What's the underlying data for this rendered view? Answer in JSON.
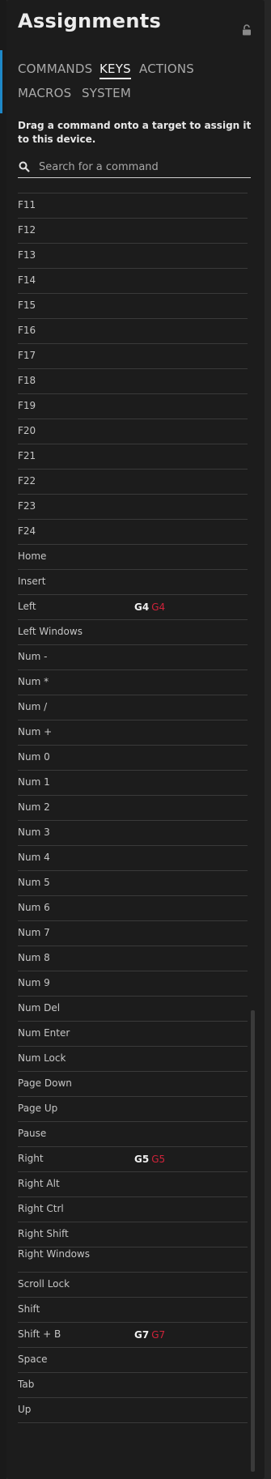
{
  "panel": {
    "title": "Assignments",
    "lock_icon": "unlock-icon"
  },
  "tabs": [
    {
      "label": "COMMANDS",
      "active": false
    },
    {
      "label": "KEYS",
      "active": true
    },
    {
      "label": "ACTIONS",
      "active": false
    },
    {
      "label": "MACROS",
      "active": false
    },
    {
      "label": "SYSTEM",
      "active": false
    }
  ],
  "instructions": "Drag a command onto a target to assign it to this device.",
  "search": {
    "placeholder": "Search for a command",
    "value": "",
    "icon": "search-icon"
  },
  "colors": {
    "accent": "#1e88c8",
    "assigned_red": "#d0233a"
  },
  "keys": [
    {
      "label": "F11"
    },
    {
      "label": "F12"
    },
    {
      "label": "F13"
    },
    {
      "label": "F14"
    },
    {
      "label": "F15"
    },
    {
      "label": "F16"
    },
    {
      "label": "F17"
    },
    {
      "label": "F18"
    },
    {
      "label": "F19"
    },
    {
      "label": "F20"
    },
    {
      "label": "F21"
    },
    {
      "label": "F22"
    },
    {
      "label": "F23"
    },
    {
      "label": "F24"
    },
    {
      "label": "Home"
    },
    {
      "label": "Insert"
    },
    {
      "label": "Left",
      "assigned": "G4",
      "assigned_alt": "G4"
    },
    {
      "label": "Left Windows"
    },
    {
      "label": "Num -"
    },
    {
      "label": "Num *"
    },
    {
      "label": "Num /"
    },
    {
      "label": "Num +"
    },
    {
      "label": "Num 0"
    },
    {
      "label": "Num 1"
    },
    {
      "label": "Num 2"
    },
    {
      "label": "Num 3"
    },
    {
      "label": "Num 4"
    },
    {
      "label": "Num 5"
    },
    {
      "label": "Num 6"
    },
    {
      "label": "Num 7"
    },
    {
      "label": "Num 8"
    },
    {
      "label": "Num 9"
    },
    {
      "label": "Num Del"
    },
    {
      "label": "Num Enter"
    },
    {
      "label": "Num Lock"
    },
    {
      "label": "Page Down"
    },
    {
      "label": "Page Up"
    },
    {
      "label": "Pause"
    },
    {
      "label": "Right",
      "assigned": "G5",
      "assigned_alt": "G5"
    },
    {
      "label": "Right Alt"
    },
    {
      "label": "Right Ctrl"
    },
    {
      "label": "Right Shift"
    },
    {
      "label": "Right Windows"
    },
    {
      "label": "Scroll Lock"
    },
    {
      "label": "Shift"
    },
    {
      "label": "Shift + B",
      "assigned": "G7",
      "assigned_alt": "G7"
    },
    {
      "label": "Space"
    },
    {
      "label": "Tab"
    },
    {
      "label": "Up"
    }
  ]
}
